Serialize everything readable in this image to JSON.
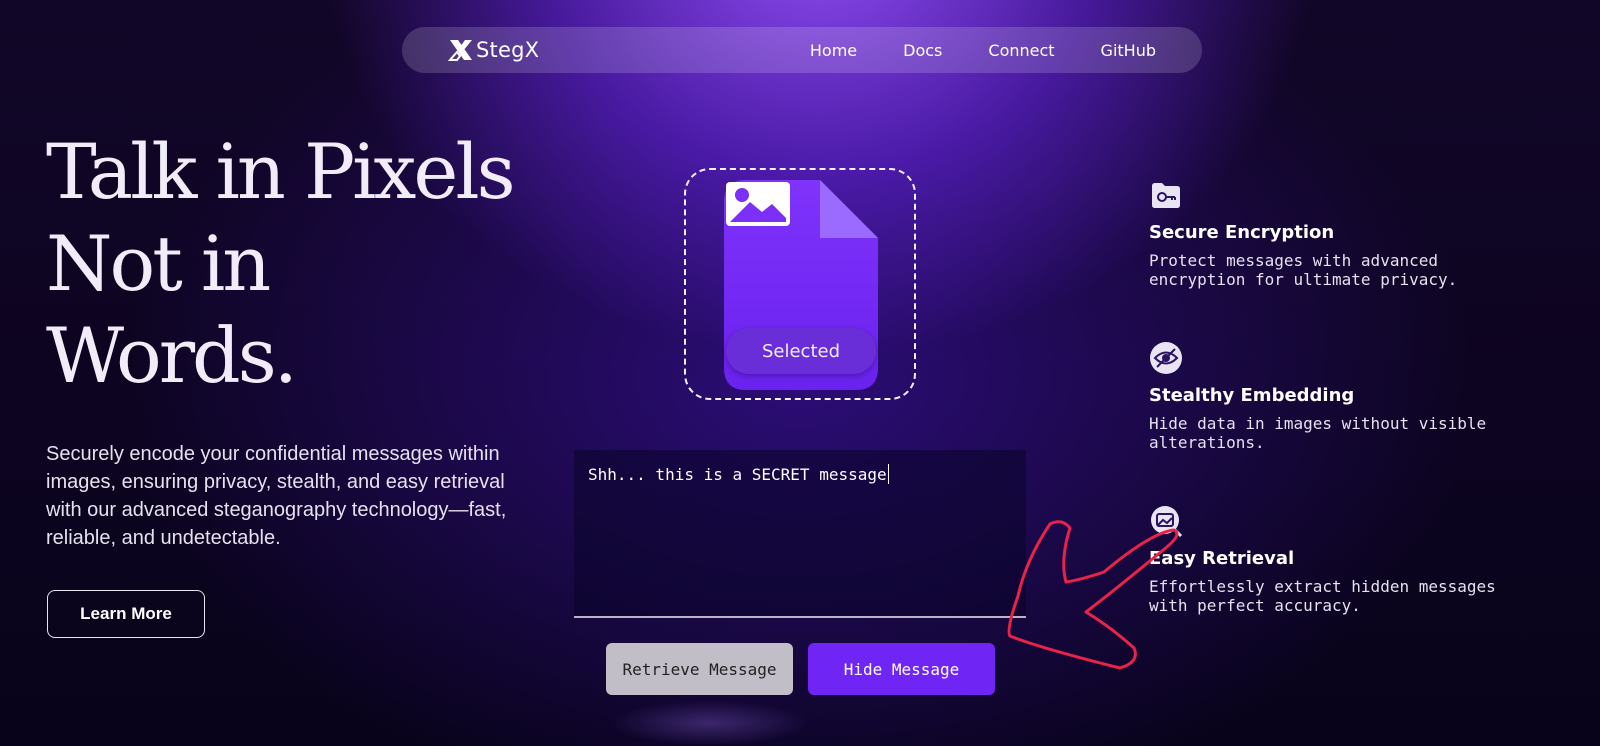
{
  "nav": {
    "brand": "StegX",
    "links": [
      "Home",
      "Docs",
      "Connect",
      "GitHub"
    ]
  },
  "hero": {
    "title": "Talk in Pixels\nNot in\nWords.",
    "description": "Securely encode your confidential messages within images, ensuring privacy, stealth, and easy retrieval with our advanced steganography technology—fast, reliable, and undetectable.",
    "cta": "Learn More"
  },
  "upload": {
    "status": "Selected",
    "icon": "image-icon"
  },
  "message": {
    "value": "Shh... this is a SECRET message"
  },
  "actions": {
    "retrieve": "Retrieve Message",
    "hide": "Hide Message"
  },
  "features": [
    {
      "icon": "folder-key-icon",
      "title": "Secure Encryption",
      "description": "Protect messages with advanced encryption for ultimate privacy."
    },
    {
      "icon": "eye-off-icon",
      "title": "Stealthy Embedding",
      "description": "Hide data in images without visible alterations."
    },
    {
      "icon": "image-search-icon",
      "title": "Easy Retrieval",
      "description": "Effortlessly extract hidden messages with perfect accuracy."
    }
  ],
  "colors": {
    "accent": "#6f26f5",
    "file_card": "#7b2ff7",
    "annotation_arrow": "#e8234a"
  }
}
